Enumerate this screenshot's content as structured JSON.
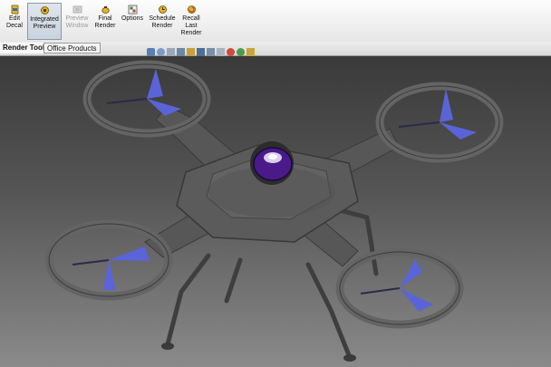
{
  "ribbon": {
    "buttons": [
      {
        "name": "edit-decal-button",
        "label": "Edit\nDecal",
        "icon": "decal-icon",
        "state": "normal"
      },
      {
        "name": "integrated-preview-button",
        "label": "Integrated\nPreview",
        "icon": "preview-icon",
        "state": "active"
      },
      {
        "name": "preview-window-button",
        "label": "Preview\nWindow",
        "icon": "preview-window-icon",
        "state": "disabled"
      },
      {
        "name": "final-render-button",
        "label": "Final\nRender",
        "icon": "render-teapot-icon",
        "state": "normal"
      },
      {
        "name": "options-button",
        "label": "Options",
        "icon": "options-icon",
        "state": "normal"
      },
      {
        "name": "schedule-render-button",
        "label": "Schedule\nRender",
        "icon": "schedule-icon",
        "state": "normal"
      },
      {
        "name": "recall-last-render-button",
        "label": "Recall\nLast\nRender",
        "icon": "recall-icon",
        "state": "normal"
      }
    ]
  },
  "tabs": {
    "active": "Render Tools",
    "other": "Office Products"
  },
  "colors": {
    "accent": "#5a64d8",
    "body": "#555555",
    "dome": "#4b1a8a",
    "background_top": "#3a3a3a",
    "background_bottom": "#8a8a8a"
  }
}
